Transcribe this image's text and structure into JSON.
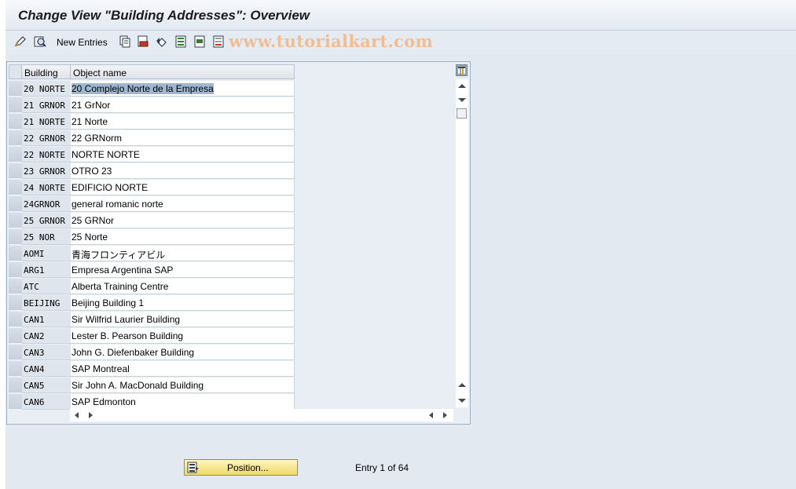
{
  "title": "Change View \"Building Addresses\": Overview",
  "toolbar": {
    "new_entries_label": "New Entries",
    "icons": [
      "edit-icon",
      "display-icon",
      "copy-icon",
      "delete-icon",
      "undo-icon",
      "select-all-icon",
      "select-block-icon",
      "deselect-all-icon"
    ]
  },
  "watermark": "www.tutorialkart.com",
  "table": {
    "columns": [
      "Building",
      "Object name"
    ],
    "rows": [
      {
        "code": "20 NORTE",
        "name": "20 Complejo Norte de la Empresa"
      },
      {
        "code": "21 GRNOR",
        "name": "21 GrNor"
      },
      {
        "code": "21 NORTE",
        "name": "21 Norte"
      },
      {
        "code": "22 GRNOR",
        "name": "22 GRNorm"
      },
      {
        "code": "22 NORTE",
        "name": "NORTE NORTE"
      },
      {
        "code": "23 GRNOR",
        "name": "OTRO 23"
      },
      {
        "code": "24 NORTE",
        "name": "EDIFICIO NORTE"
      },
      {
        "code": "24GRNOR",
        "name": "general romanic norte"
      },
      {
        "code": "25 GRNOR",
        "name": "25 GRNor"
      },
      {
        "code": "25 NOR",
        "name": "25 Norte"
      },
      {
        "code": "AOMI",
        "name": "青海フロンティアビル"
      },
      {
        "code": "ARG1",
        "name": "Empresa Argentina SAP"
      },
      {
        "code": "ATC",
        "name": "Alberta Training Centre"
      },
      {
        "code": "BEIJING",
        "name": "Beijing Building 1"
      },
      {
        "code": "CAN1",
        "name": "Sir Wilfrid Laurier Building"
      },
      {
        "code": "CAN2",
        "name": "Lester B. Pearson Building"
      },
      {
        "code": "CAN3",
        "name": "John G. Diefenbaker Building"
      },
      {
        "code": "CAN4",
        "name": "SAP Montreal"
      },
      {
        "code": "CAN5",
        "name": "Sir John A. MacDonald Building"
      },
      {
        "code": "CAN6",
        "name": "SAP Edmonton"
      }
    ]
  },
  "footer": {
    "position_button_label": "Position...",
    "entry_text": "Entry 1 of 64"
  }
}
